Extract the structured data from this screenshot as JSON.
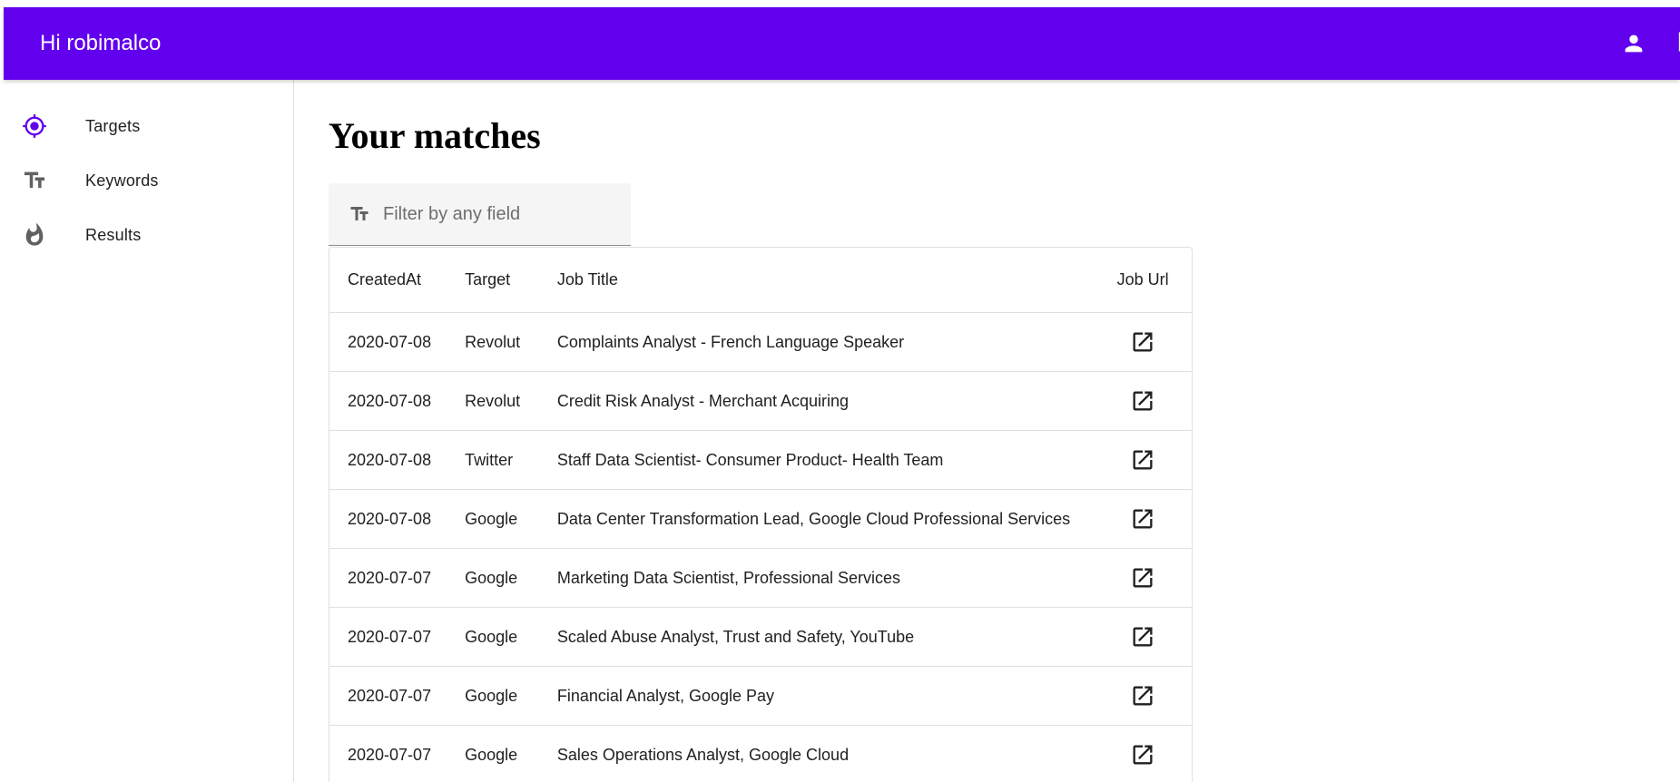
{
  "appbar": {
    "greeting": "Hi robimalco",
    "account_icon": "account-icon",
    "logout_icon": "logout-icon",
    "color": "#6200ee"
  },
  "sidebar": {
    "items": [
      {
        "label": "Targets",
        "icon": "target-icon",
        "color": "#6200ee"
      },
      {
        "label": "Keywords",
        "icon": "text-fields-icon",
        "color": "#616161"
      },
      {
        "label": "Results",
        "icon": "fire-icon",
        "color": "#616161"
      }
    ]
  },
  "main": {
    "title": "Your matches",
    "filter": {
      "placeholder": "Filter by any field",
      "value": "",
      "icon": "text-fields-icon"
    },
    "table": {
      "headers": {
        "created_at": "CreatedAt",
        "target": "Target",
        "job_title": "Job Title",
        "job_url": "Job Url"
      },
      "rows": [
        {
          "created_at": "2020-07-08",
          "target": "Revolut",
          "job_title": "Complaints Analyst - French Language Speaker",
          "url_icon": "open-in-new-icon"
        },
        {
          "created_at": "2020-07-08",
          "target": "Revolut",
          "job_title": "Credit Risk Analyst - Merchant Acquiring",
          "url_icon": "open-in-new-icon"
        },
        {
          "created_at": "2020-07-08",
          "target": "Twitter",
          "job_title": "Staff Data Scientist- Consumer Product- Health Team",
          "url_icon": "open-in-new-icon"
        },
        {
          "created_at": "2020-07-08",
          "target": "Google",
          "job_title": "Data Center Transformation Lead, Google Cloud Professional Services",
          "url_icon": "open-in-new-icon"
        },
        {
          "created_at": "2020-07-07",
          "target": "Google",
          "job_title": "Marketing Data Scientist, Professional Services",
          "url_icon": "open-in-new-icon"
        },
        {
          "created_at": "2020-07-07",
          "target": "Google",
          "job_title": "Scaled Abuse Analyst, Trust and Safety, YouTube",
          "url_icon": "open-in-new-icon"
        },
        {
          "created_at": "2020-07-07",
          "target": "Google",
          "job_title": "Financial Analyst, Google Pay",
          "url_icon": "open-in-new-icon"
        },
        {
          "created_at": "2020-07-07",
          "target": "Google",
          "job_title": "Sales Operations Analyst, Google Cloud",
          "url_icon": "open-in-new-icon"
        }
      ]
    }
  }
}
